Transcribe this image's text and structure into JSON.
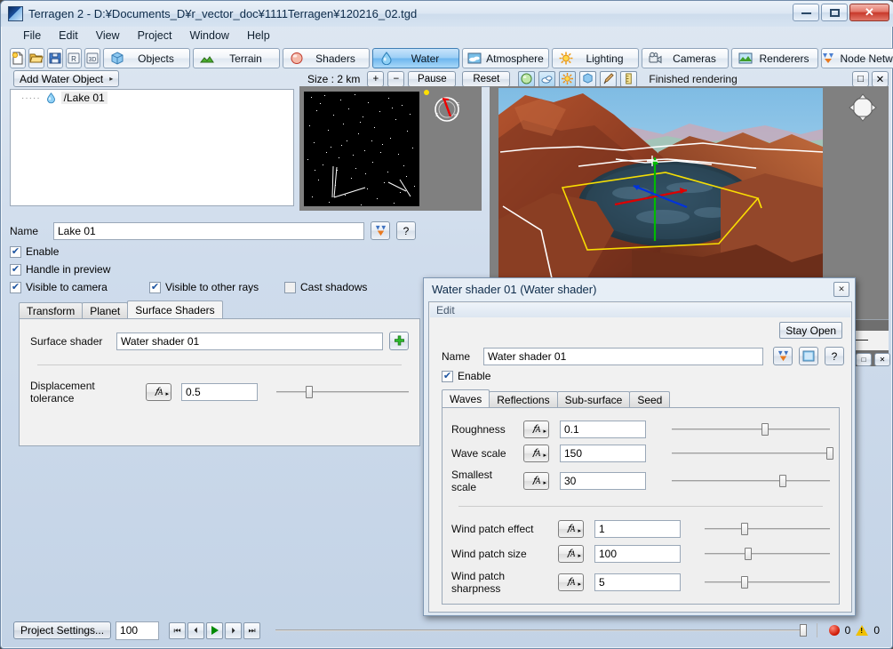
{
  "window": {
    "title": "Terragen 2 - D:¥Documents_D¥r_vector_doc¥1111Terragen¥120216_02.tgd",
    "minimize": "–",
    "maximize": "□",
    "close": "✕"
  },
  "menubar": [
    "File",
    "Edit",
    "View",
    "Project",
    "Window",
    "Help"
  ],
  "toolbar": {
    "file_buttons": [
      "new-icon",
      "open-icon",
      "save-icon",
      "render-icon",
      "3d-icon"
    ],
    "tabs": [
      {
        "label": "Objects",
        "icon": "cube-icon",
        "active": false
      },
      {
        "label": "Terrain",
        "icon": "terrain-icon",
        "active": false
      },
      {
        "label": "Shaders",
        "icon": "sphere-icon",
        "active": false
      },
      {
        "label": "Water",
        "icon": "droplet-icon",
        "active": true
      },
      {
        "label": "Atmosphere",
        "icon": "clouds-icon",
        "active": false
      },
      {
        "label": "Lighting",
        "icon": "sun-icon",
        "active": false
      },
      {
        "label": "Cameras",
        "icon": "camera-icon",
        "active": false
      },
      {
        "label": "Renderers",
        "icon": "landscape-icon",
        "active": false
      },
      {
        "label": "Node Network",
        "icon": "node-icon",
        "active": false
      }
    ]
  },
  "left_panel": {
    "add_button": "Add Water Object",
    "add_button_arrow": "▸",
    "tree": [
      {
        "icon": "droplet-icon",
        "label": "/Lake 01",
        "dots": "·····"
      }
    ]
  },
  "render_toolbar": {
    "size_label": "Size :  2 km",
    "plus": "+",
    "minus": "−",
    "pause": "Pause",
    "reset": "Reset",
    "mode_icons": [
      "globe-icon",
      "cloud-icon",
      "sun-icon",
      "cube-icon",
      "brush-icon",
      "ruler-icon"
    ],
    "status": "Finished rendering",
    "restore_icon": "□",
    "close_icon": "✕"
  },
  "properties": {
    "name_label": "Name",
    "name_value": "Lake 01",
    "node_icon": "node-icon",
    "help_icon": "?",
    "checkboxes": [
      {
        "label": "Enable",
        "checked": true
      },
      {
        "label": "Handle in preview",
        "checked": true
      },
      {
        "label": "Visible to camera",
        "checked": true
      },
      {
        "label": "Visible to other rays",
        "checked": true
      },
      {
        "label": "Cast shadows",
        "checked": false
      }
    ],
    "tabs": [
      {
        "label": "Transform",
        "selected": false
      },
      {
        "label": "Planet",
        "selected": false
      },
      {
        "label": "Surface Shaders",
        "selected": true
      }
    ],
    "surface_shader_label": "Surface shader",
    "surface_shader_value": "Water shader 01",
    "add_shader_icon": "plus-icon",
    "displacement_label": "Displacement tolerance",
    "displacement_func_icon": "function-icon",
    "displacement_value": "0.5",
    "displacement_slider_pct": 22
  },
  "dialog": {
    "title": "Water shader 01    (Water shader)",
    "close_icon": "✕",
    "menu": "Edit",
    "stay_open": "Stay Open",
    "name_label": "Name",
    "name_value": "Water shader 01",
    "node_icon": "node-icon",
    "preview_icon": "preview-icon",
    "help_icon": "?",
    "enable": {
      "label": "Enable",
      "checked": true
    },
    "tabs": [
      {
        "label": "Waves",
        "selected": true
      },
      {
        "label": "Reflections",
        "selected": false
      },
      {
        "label": "Sub-surface",
        "selected": false
      },
      {
        "label": "Seed",
        "selected": false
      }
    ],
    "wave_params": [
      {
        "label": "Roughness",
        "func_icon": "function-icon",
        "value": "0.1",
        "slider_pct": 57
      },
      {
        "label": "Wave scale",
        "func_icon": "function-icon",
        "value": "150",
        "slider_pct": 99
      },
      {
        "label": "Smallest scale",
        "func_icon": "function-icon",
        "value": "30",
        "slider_pct": 68
      }
    ],
    "wind_params": [
      {
        "label": "Wind patch effect",
        "func_icon": "function-icon",
        "value": "1",
        "slider_pct": 29
      },
      {
        "label": "Wind patch size",
        "func_icon": "function-icon",
        "value": "100",
        "slider_pct": 32
      },
      {
        "label": "Wind patch sharpness",
        "func_icon": "function-icon",
        "value": "5",
        "slider_pct": 29
      }
    ]
  },
  "bottombar": {
    "project_settings": "Project Settings...",
    "frame_value": "100",
    "transport": [
      "⏮",
      "⏴",
      "▶",
      "⏵",
      "⏭"
    ],
    "error_count": "0",
    "warning_count": "0"
  },
  "colors": {
    "accent": "#6db6ee",
    "error": "#cc1400",
    "warning": "#f0c000",
    "titlebar": "#d6e3f1"
  }
}
